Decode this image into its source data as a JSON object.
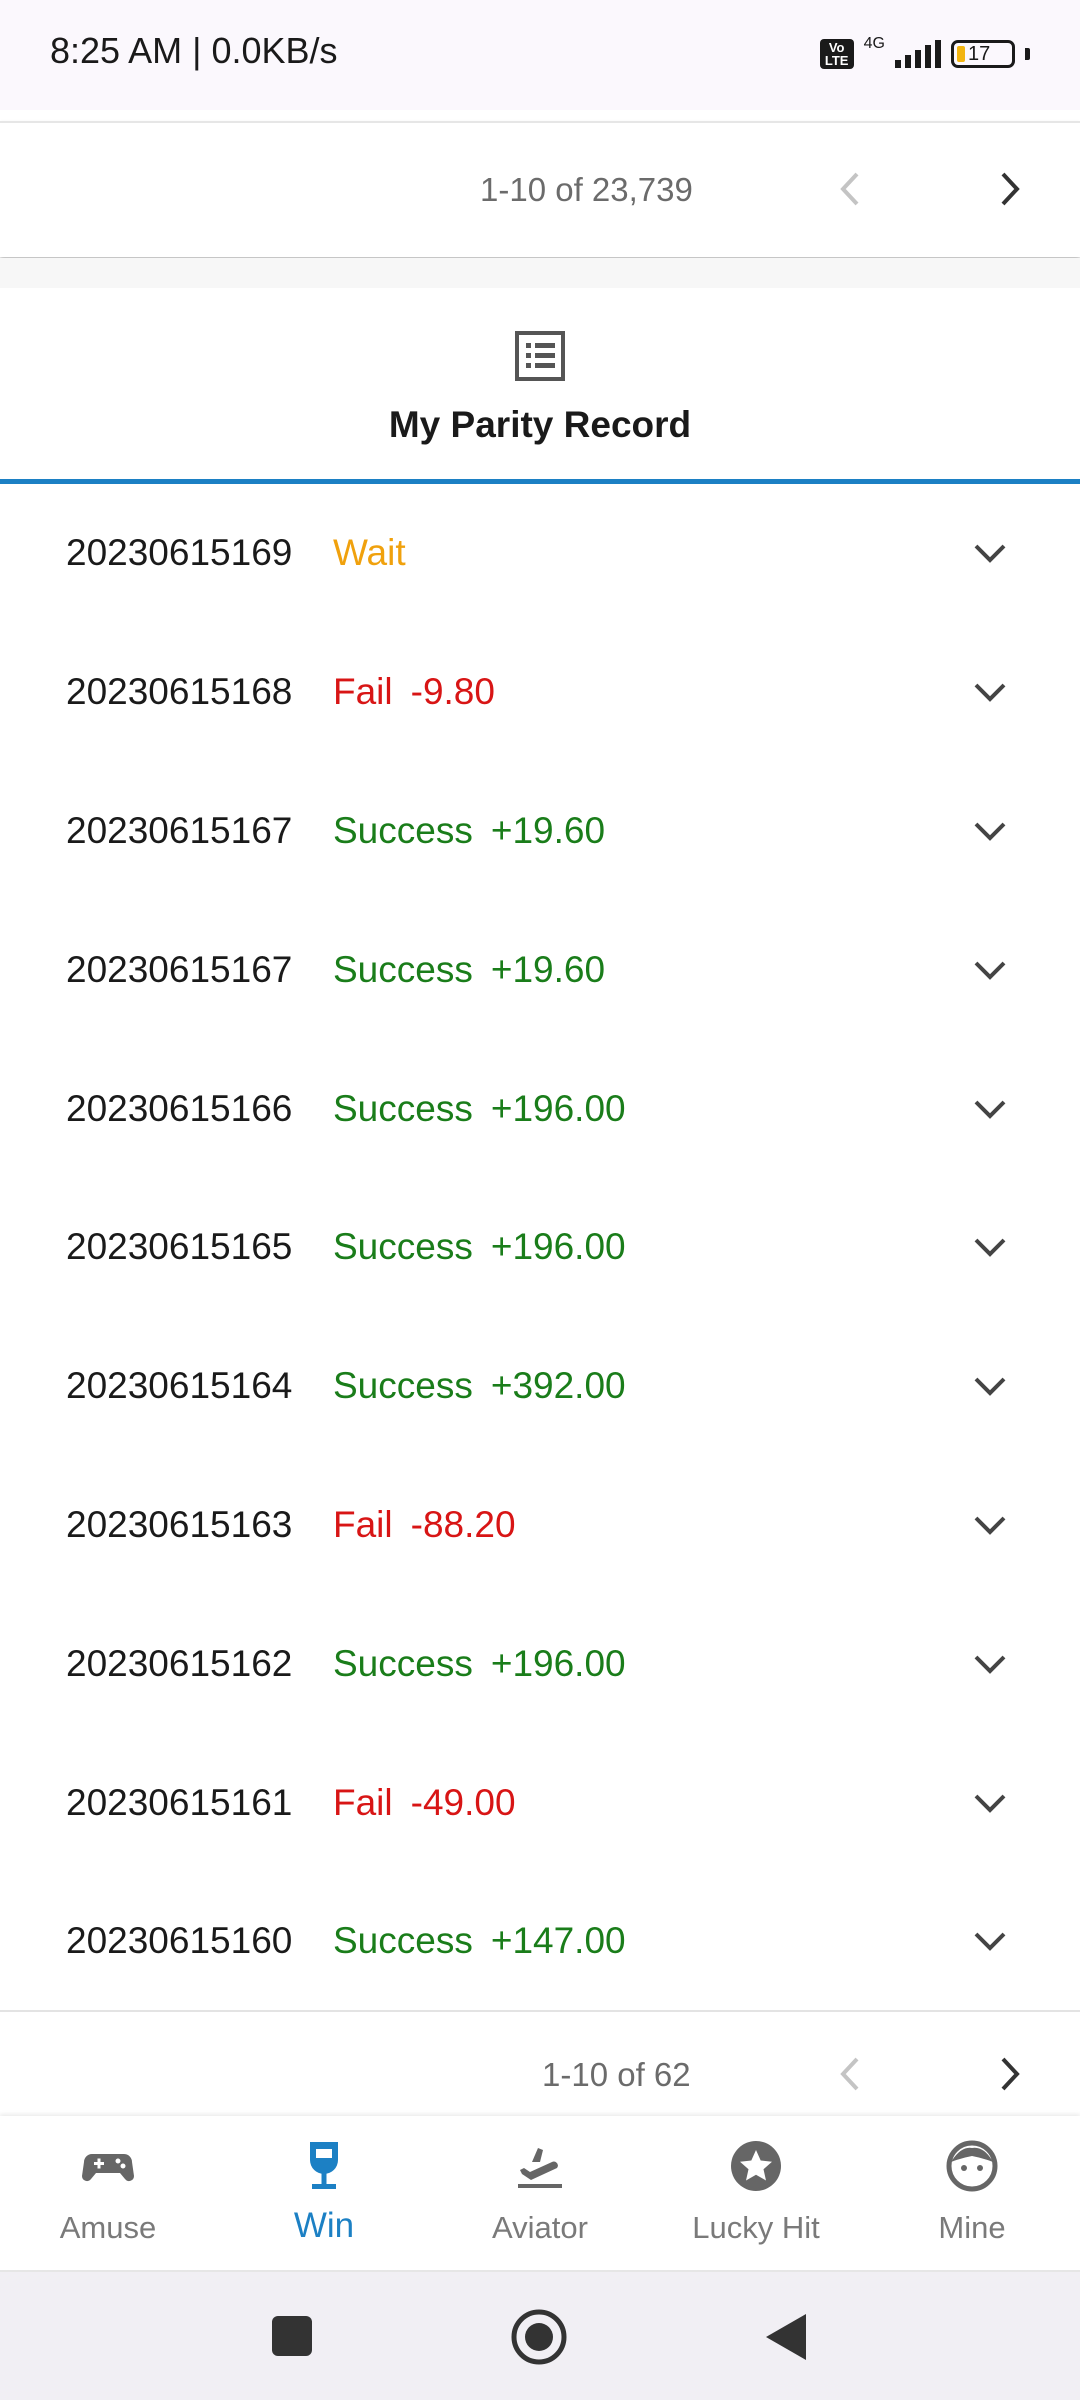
{
  "status_bar": {
    "time": "8:25 AM | 0.0KB/s",
    "volte": "Vo LTE",
    "network": "4G",
    "battery": "17"
  },
  "top_pager": {
    "range": "1-10 of 23,739"
  },
  "record_header": {
    "title": "My Parity Record",
    "icon": "list-document-icon"
  },
  "records": [
    {
      "period": "20230615169",
      "status": "Wait",
      "amount": "",
      "type": "wait"
    },
    {
      "period": "20230615168",
      "status": "Fail",
      "amount": "-9.80",
      "type": "fail"
    },
    {
      "period": "20230615167",
      "status": "Success",
      "amount": "+19.60",
      "type": "success"
    },
    {
      "period": "20230615167",
      "status": "Success",
      "amount": "+19.60",
      "type": "success"
    },
    {
      "period": "20230615166",
      "status": "Success",
      "amount": "+196.00",
      "type": "success"
    },
    {
      "period": "20230615165",
      "status": "Success",
      "amount": "+196.00",
      "type": "success"
    },
    {
      "period": "20230615164",
      "status": "Success",
      "amount": "+392.00",
      "type": "success"
    },
    {
      "period": "20230615163",
      "status": "Fail",
      "amount": "-88.20",
      "type": "fail"
    },
    {
      "period": "20230615162",
      "status": "Success",
      "amount": "+196.00",
      "type": "success"
    },
    {
      "period": "20230615161",
      "status": "Fail",
      "amount": "-49.00",
      "type": "fail"
    },
    {
      "period": "20230615160",
      "status": "Success",
      "amount": "+147.00",
      "type": "success"
    }
  ],
  "bottom_pager": {
    "range": "1-10 of 62"
  },
  "bottom_nav": [
    {
      "label": "Amuse",
      "icon": "gamepad-icon"
    },
    {
      "label": "Win",
      "icon": "trophy-cup-icon",
      "active": true
    },
    {
      "label": "Aviator",
      "icon": "airplane-icon"
    },
    {
      "label": "Lucky Hit",
      "icon": "star-badge-icon"
    },
    {
      "label": "Mine",
      "icon": "face-icon"
    }
  ],
  "colors": {
    "accent": "#1c80c4",
    "wait": "#f0a10d",
    "fail": "#d81515",
    "success": "#1a7d1a"
  }
}
